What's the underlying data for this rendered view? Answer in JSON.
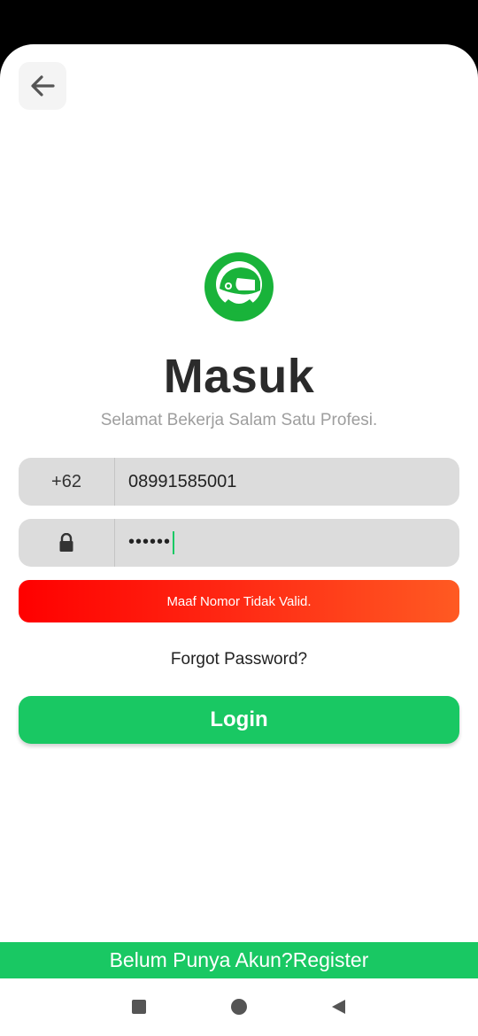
{
  "header": {
    "back_icon": "arrow-left-icon"
  },
  "brand": {
    "logo_icon": "helmet-logo-icon",
    "logo_color": "#19b33a"
  },
  "login": {
    "title": "Masuk",
    "subtitle": "Selamat Bekerja Salam Satu Profesi.",
    "phone": {
      "country_code": "+62",
      "value": "08991585001"
    },
    "password": {
      "icon": "lock-icon",
      "masked_value": "••••••"
    },
    "error_message": "Maaf Nomor Tidak Valid.",
    "forgot_label": "Forgot Password?",
    "login_label": "Login"
  },
  "footer": {
    "prompt": "Belum Punya Akun?",
    "register_label": "Register"
  },
  "colors": {
    "primary_green": "#19c863",
    "error_start": "#ff0000",
    "error_end": "#ff5a22"
  },
  "system_nav": {
    "recents_icon": "square-icon",
    "home_icon": "circle-icon",
    "back_icon": "triangle-back-icon"
  }
}
